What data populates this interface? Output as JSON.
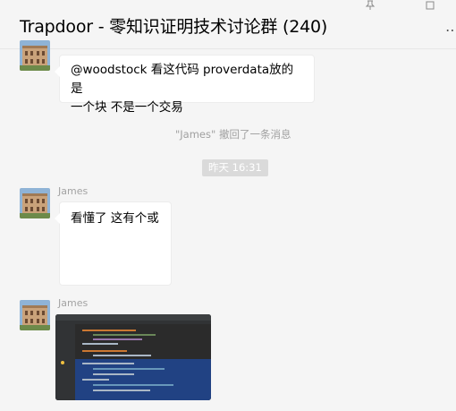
{
  "window": {
    "title": "Trapdoor - 零知识证明技术讨论群 (240)",
    "pin_icon": "pin-icon",
    "restore_icon": "window-restore-icon",
    "more_icon": "more-icon"
  },
  "messages": [
    {
      "type": "text",
      "sender": "",
      "avatar_icon": "building-avatar-icon",
      "lines": [
        "@woodstock 看这代码 proverdata放的是",
        "一个块 不是一个交易"
      ]
    },
    {
      "type": "system",
      "text": "\"James\" 撤回了一条消息"
    },
    {
      "type": "timestamp",
      "text": "昨天 16:31"
    },
    {
      "type": "text",
      "sender": "James",
      "avatar_icon": "building-avatar-icon",
      "lines": [
        "看懂了  这有个或"
      ]
    },
    {
      "type": "image",
      "sender": "James",
      "avatar_icon": "building-avatar-icon",
      "image_desc": "code-screenshot"
    }
  ],
  "colors": {
    "background": "#f5f5f5",
    "bubble": "#ffffff",
    "sender": "#a3a3a3",
    "system": "#a0a0a0",
    "time_pill": "#dadada",
    "code_selection": "#214283"
  }
}
